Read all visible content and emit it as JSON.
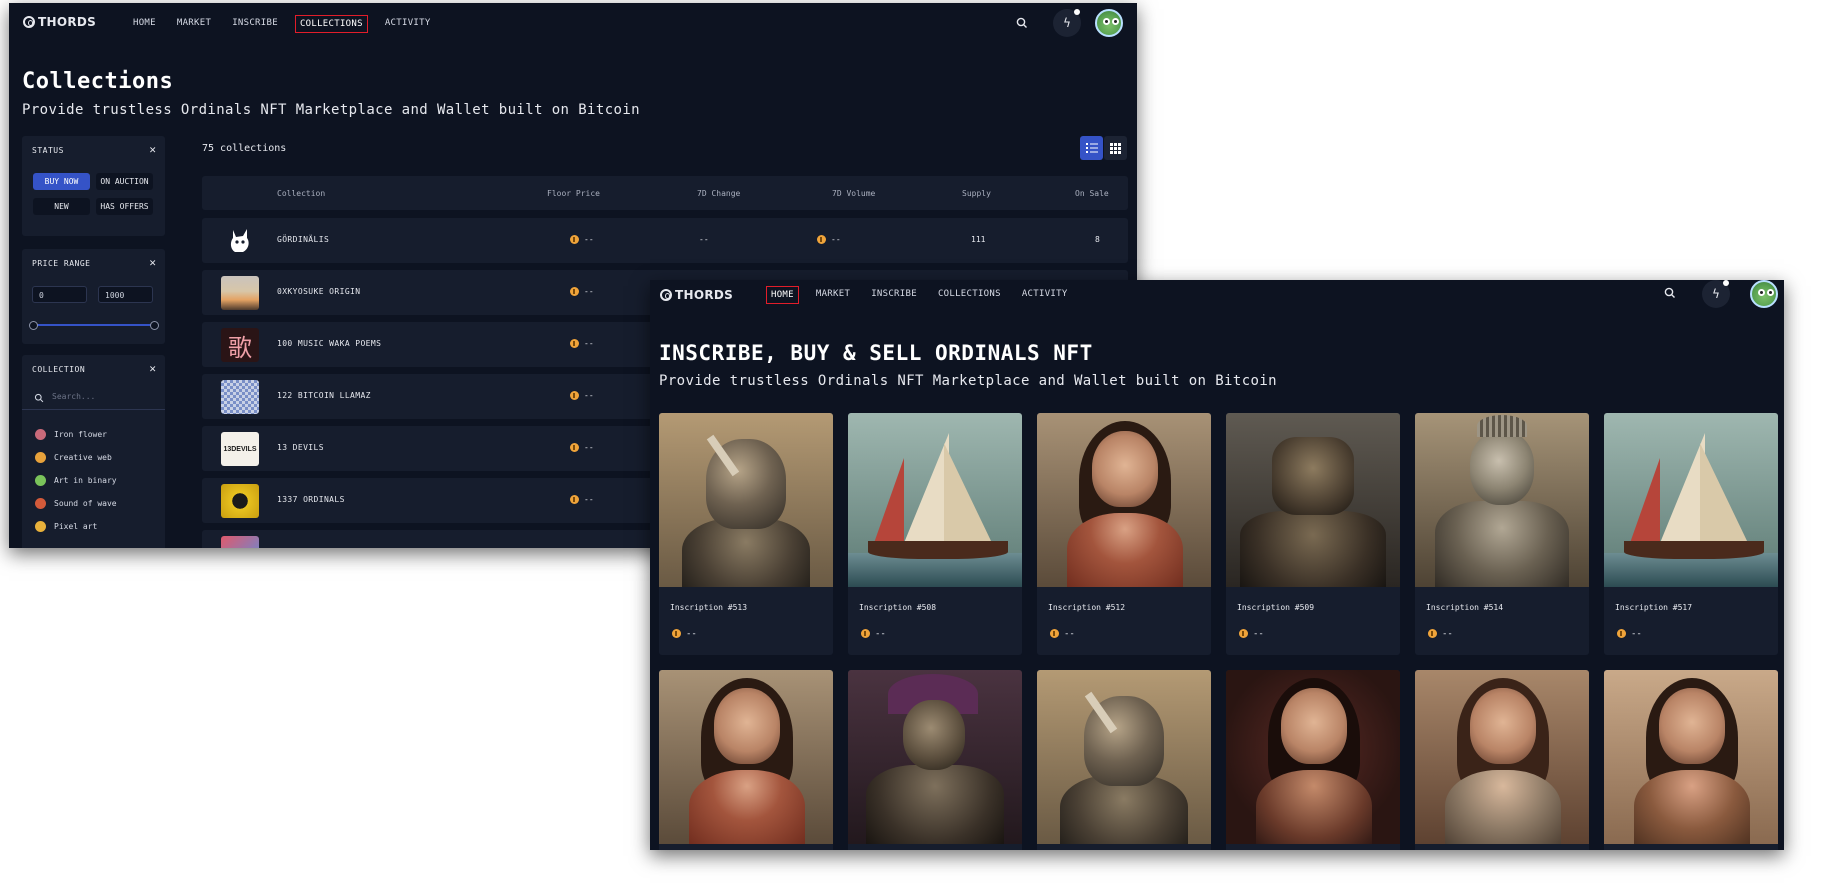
{
  "brand": "THORDS",
  "nav": [
    "HOME",
    "MARKET",
    "INSCRIBE",
    "COLLECTIONS",
    "ACTIVITY"
  ],
  "collections_page": {
    "title": "Collections",
    "subtitle": "Provide trustless Ordinals NFT Marketplace and Wallet built on Bitcoin",
    "status": {
      "heading": "STATUS",
      "buttons": [
        "BUY NOW",
        "ON AUCTION",
        "NEW",
        "HAS OFFERS"
      ],
      "active": "BUY NOW"
    },
    "price_range": {
      "heading": "PRICE RANGE",
      "min": "0",
      "max": "1000"
    },
    "collection_filter": {
      "heading": "COLLECTION",
      "placeholder": "Search...",
      "items": [
        {
          "label": "Iron flower",
          "color": "#c96a7a"
        },
        {
          "label": "Creative web",
          "color": "#e8a23b"
        },
        {
          "label": "Art in binary",
          "color": "#7ac35a"
        },
        {
          "label": "Sound of wave",
          "color": "#d35a3a"
        },
        {
          "label": "Pixel art",
          "color": "#e8b13b"
        }
      ]
    },
    "count": "75 collections",
    "columns": [
      "Collection",
      "Floor Price",
      "7D Change",
      "7D Volume",
      "Supply",
      "On Sale"
    ],
    "rows": [
      {
        "name": "GÖRDINÄLIS",
        "floor": "--",
        "change": "--",
        "volume": "--",
        "supply": "111",
        "on_sale": "8"
      },
      {
        "name": "0XKYOSUKE ORIGIN",
        "floor": "--"
      },
      {
        "name": "100 MUSIC WAKA POEMS",
        "floor": "--",
        "thumb_text": "歌"
      },
      {
        "name": "122 BITCOIN LLAMAZ",
        "floor": "--"
      },
      {
        "name": "13 DEVILS",
        "floor": "--",
        "thumb_text": "13DEVILS"
      },
      {
        "name": "1337 ORDINALS",
        "floor": "--"
      }
    ]
  },
  "home_page": {
    "title": "INSCRIBE, BUY & SELL ORDINALS NFT",
    "subtitle": "Provide trustless Ordinals NFT Marketplace and Wallet built on Bitcoin",
    "cards": [
      {
        "title": "Inscription #513",
        "price": "--"
      },
      {
        "title": "Inscription #508",
        "price": "--"
      },
      {
        "title": "Inscription #512",
        "price": "--"
      },
      {
        "title": "Inscription #509",
        "price": "--"
      },
      {
        "title": "Inscription #514",
        "price": "--"
      },
      {
        "title": "Inscription #517",
        "price": "--"
      }
    ]
  },
  "colors": {
    "background": "#0d1321",
    "panel": "#161d2d",
    "accent": "#3553c7",
    "highlight": "#e11d2a",
    "coin": "#f0a43a"
  }
}
